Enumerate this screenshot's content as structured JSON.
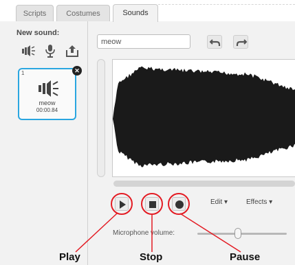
{
  "tabs": [
    {
      "label": "Scripts"
    },
    {
      "label": "Costumes"
    },
    {
      "label": "Sounds"
    }
  ],
  "new_sound": {
    "label": "New sound:",
    "options": [
      "speaker-library-icon",
      "microphone-icon",
      "upload-icon"
    ]
  },
  "sound_list": [
    {
      "number": "1",
      "name": "meow",
      "duration": "00:00.84"
    }
  ],
  "editor": {
    "sound_name": "meow",
    "edit_menu": "Edit ▾",
    "effects_menu": "Effects ▾",
    "mic_volume_label": "Microphone volume:",
    "mic_volume_level": 0.45
  },
  "annotations": {
    "play": "Play",
    "stop": "Stop",
    "pause": "Pause"
  },
  "colors": {
    "accent": "#2aa6e0",
    "annotation": "#e31b23",
    "waveform": "#1a1a1a"
  }
}
